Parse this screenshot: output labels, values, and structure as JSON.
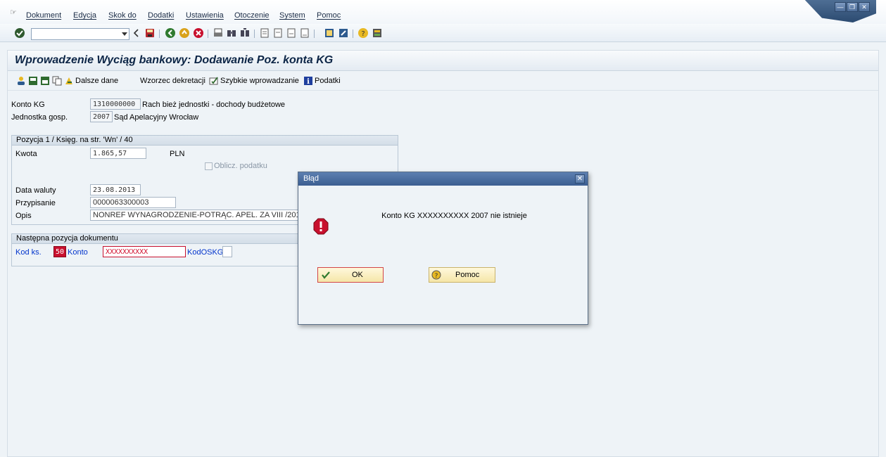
{
  "menubar": {
    "items": [
      "Dokument",
      "Edycja",
      "Skok do",
      "Dodatki",
      "Ustawienia",
      "Otoczenie",
      "System",
      "Pomoc"
    ]
  },
  "toolbar": {
    "command_value": ""
  },
  "page": {
    "title": "Wprowadzenie Wyciąg bankowy: Dodawanie Poz. konta KG"
  },
  "apptoolbar": {
    "dalsze_dane": "Dalsze dane",
    "wzorzec": "Wzorzec dekretacji",
    "szybkie": "Szybkie wprowadzanie",
    "podatki": "Podatki"
  },
  "header_fields": {
    "konto_kg_label": "Konto KG",
    "konto_kg_value": "1310000000",
    "konto_kg_text": "Rach bież jednostki - dochody budżetowe",
    "jednostka_label": "Jednostka gosp.",
    "jednostka_value": "2007",
    "jednostka_text": "Sąd Apelacyjny Wrocław"
  },
  "position_group": {
    "title": "Pozycja 1 / Księg. na str. 'Wn' / 40",
    "kwota_label": "Kwota",
    "kwota_value": "1.865,57",
    "currency": "PLN",
    "oblicz_label": "Oblicz. podatku",
    "data_waluty_label": "Data waluty",
    "data_waluty_value": "23.08.2013",
    "przypisanie_label": "Przypisanie",
    "przypisanie_value": "0000063300003",
    "opis_label": "Opis",
    "opis_value": "NONREF WYNAGRODZENIE-POTRĄC. APEL. ZA VIII /2013 P"
  },
  "next_item_group": {
    "title": "Następna pozycja dokumentu",
    "kod_ks_label": "Kod ks.",
    "kod_ks_value": "50",
    "konto_label": "Konto",
    "konto_value": "XXXXXXXXXX",
    "kodoskg_label": "KodOSKG",
    "kodoskg_value": ""
  },
  "dialog": {
    "title": "Błąd",
    "message": "Konto KG XXXXXXXXXX 2007 nie istnieje",
    "ok_label": "OK",
    "help_label": "Pomoc"
  },
  "colors": {
    "title_text": "#0c2546",
    "error_red": "#c8102e",
    "field_label_blue": "#0033cc",
    "dialog_title_bg": "#3b5e91"
  }
}
